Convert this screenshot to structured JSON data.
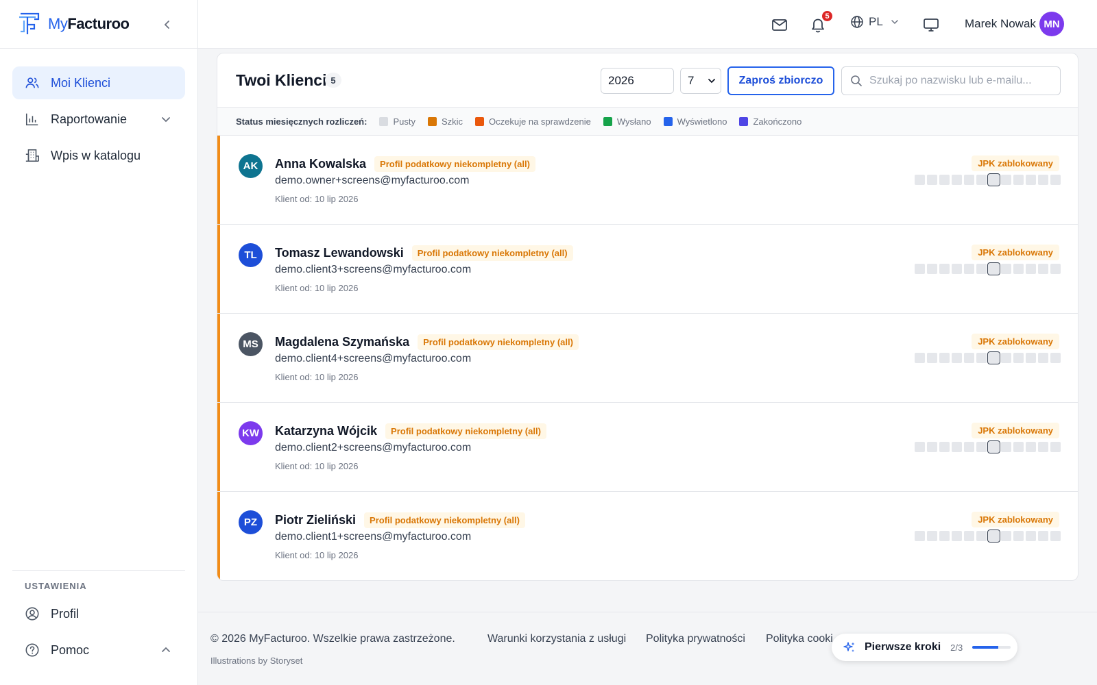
{
  "app": {
    "logo_part1": "My",
    "logo_part2": "Facturoo"
  },
  "sidebar": {
    "items": [
      {
        "label": "Moi Klienci",
        "active": true,
        "icon": "users-icon"
      },
      {
        "label": "Raportowanie",
        "active": false,
        "icon": "bar-chart-icon",
        "expandable": true
      },
      {
        "label": "Wpis w katalogu",
        "active": false,
        "icon": "building-icon"
      }
    ],
    "settings_heading": "USTAWIENIA",
    "bottom_items": [
      {
        "label": "Profil",
        "icon": "user-circle-icon"
      },
      {
        "label": "Pomoc",
        "icon": "help-circle-icon",
        "expanded": true
      }
    ]
  },
  "header": {
    "notifications_count": "5",
    "language": "PL",
    "user_name": "Marek Nowak",
    "user_initials": "MN"
  },
  "clients_panel": {
    "title": "Twoi Klienci",
    "count": "5",
    "year": "2026",
    "month": "7",
    "invite_button": "Zaproś zbiorczo",
    "search_placeholder": "Szukaj po nazwisku lub e-mailu..."
  },
  "legend": {
    "label": "Status miesięcznych rozliczeń:",
    "items": [
      {
        "name": "Pusty",
        "color": "#d9dce1"
      },
      {
        "name": "Szkic",
        "color": "#d97706"
      },
      {
        "name": "Oczekuje na sprawdzenie",
        "color": "#ea580c"
      },
      {
        "name": "Wysłano",
        "color": "#16a34a"
      },
      {
        "name": "Wyświetlono",
        "color": "#2563eb"
      },
      {
        "name": "Zakończono",
        "color": "#4f46e5"
      }
    ]
  },
  "clients": [
    {
      "initials": "AK",
      "name": "Anna Kowalska",
      "email": "demo.owner+screens@myfacturoo.com",
      "since": "Klient od: 10 lip 2026",
      "tag": "Profil podatkowy niekompletny (all)",
      "jpk": "JPK zablokowany",
      "avatar_color": "#0e7490"
    },
    {
      "initials": "TL",
      "name": "Tomasz Lewandowski",
      "email": "demo.client3+screens@myfacturoo.com",
      "since": "Klient od: 10 lip 2026",
      "tag": "Profil podatkowy niekompletny (all)",
      "jpk": "JPK zablokowany",
      "avatar_color": "#1d4ed8"
    },
    {
      "initials": "MS",
      "name": "Magdalena Szymańska",
      "email": "demo.client4+screens@myfacturoo.com",
      "since": "Klient od: 10 lip 2026",
      "tag": "Profil podatkowy niekompletny (all)",
      "jpk": "JPK zablokowany",
      "avatar_color": "#4b5563"
    },
    {
      "initials": "KW",
      "name": "Katarzyna Wójcik",
      "email": "demo.client2+screens@myfacturoo.com",
      "since": "Klient od: 10 lip 2026",
      "tag": "Profil podatkowy niekompletny (all)",
      "jpk": "JPK zablokowany",
      "avatar_color": "#7c3aed"
    },
    {
      "initials": "PZ",
      "name": "Piotr Zieliński",
      "email": "demo.client1+screens@myfacturoo.com",
      "since": "Klient od: 10 lip 2026",
      "tag": "Profil podatkowy niekompletny (all)",
      "jpk": "JPK zablokowany",
      "avatar_color": "#1d4ed8"
    }
  ],
  "footer": {
    "copyright": "© 2026 MyFacturoo. Wszelkie prawa zastrzeżone.",
    "links": [
      "Warunki korzystania z usługi",
      "Polityka prywatności",
      "Polityka cooki"
    ],
    "illustrations": "Illustrations by Storyset"
  },
  "first_steps": {
    "label": "Pierwsze kroki",
    "progress_text": "2/3",
    "progress_fraction": 0.667
  }
}
